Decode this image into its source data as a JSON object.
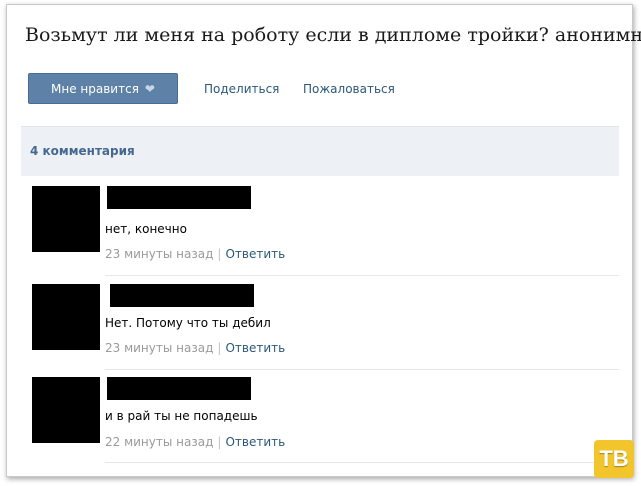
{
  "post": {
    "title": "Возьмут ли меня на роботу если в дипломе тройки? анонимно"
  },
  "actions": {
    "like_label": "Мне нравится",
    "like_icon": "heart-icon",
    "share_label": "Поделиться",
    "report_label": "Пожаловаться"
  },
  "comments_header": {
    "count_label": "4 комментария"
  },
  "comments": [
    {
      "text": "нет, конечно",
      "time": "23 минуты назад",
      "separator": "|",
      "reply_label": "Ответить"
    },
    {
      "text": "Нет. Потому что ты дебил",
      "time": "23 минуты назад",
      "separator": "|",
      "reply_label": "Ответить"
    },
    {
      "text": "и в рай ты не попадешь",
      "time": "22 минуты назад",
      "separator": "|",
      "reply_label": "Ответить"
    }
  ],
  "watermark": {
    "text": "ТВ"
  },
  "colors": {
    "accent": "#5e81a8",
    "link": "#2b587a",
    "header_bg": "#edf1f5",
    "watermark": "#f3c52d"
  }
}
